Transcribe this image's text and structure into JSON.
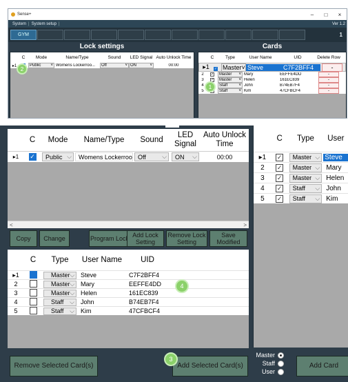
{
  "inset": {
    "title": "Sense+",
    "window_controls": [
      "–",
      "□",
      "×"
    ],
    "menu": [
      "System",
      "System setup"
    ],
    "version": "Ver 1.2",
    "active_tab": "GYM",
    "page_number": "1",
    "lock_settings_title": "Lock settings",
    "cards_title": "Cards",
    "lock_headers": [
      "C",
      "Mode",
      "Name/Type",
      "Sound",
      "LED Signal",
      "Auto Unlock Time"
    ],
    "lock_row": {
      "indicator": "▸1",
      "mode": "Public",
      "name": "Womens Lockerroo...",
      "sound": "Off",
      "led": "ON",
      "time": "00:00"
    },
    "card_headers": [
      "C",
      "Type",
      "User Name",
      "UID",
      "Delete Row"
    ],
    "cards": [
      {
        "idx": "▸1",
        "type": "Master",
        "name": "Steve",
        "uid": "C7F2BFF4",
        "del": "-"
      },
      {
        "idx": "2",
        "type": "Master",
        "name": "Mary",
        "uid": "EEFFE4DD",
        "del": "-"
      },
      {
        "idx": "3",
        "type": "Master",
        "name": "Helen",
        "uid": "161EC839",
        "del": "-"
      },
      {
        "idx": "4",
        "type": "Staff",
        "name": "John",
        "uid": "B74EB7F4",
        "del": "-"
      },
      {
        "idx": "5",
        "type": "Staff",
        "name": "Kim",
        "uid": "47CFBCF4",
        "del": "-"
      }
    ],
    "badge_1": "1",
    "badge_2": "2"
  },
  "lock_grid": {
    "headers": {
      "c": "C",
      "mode": "Mode",
      "name": "Name/Type",
      "sound": "Sound",
      "led": "LED Signal",
      "auto": "Auto Unlock Time"
    },
    "row": {
      "indicator": "▸1",
      "mode": "Public",
      "name": "Womens Lockerroo...",
      "sound": "Off",
      "led": "ON",
      "time": "00:00"
    },
    "scroll_left": "<",
    "scroll_right": ">"
  },
  "cards_grid": {
    "headers": {
      "c": "C",
      "type": "Type",
      "user": "User"
    },
    "rows": [
      {
        "idx": "▸1",
        "type": "Master",
        "name": "Steve"
      },
      {
        "idx": "2",
        "type": "Master",
        "name": "Mary"
      },
      {
        "idx": "3",
        "type": "Master",
        "name": "Helen"
      },
      {
        "idx": "4",
        "type": "Staff",
        "name": "John"
      },
      {
        "idx": "5",
        "type": "Staff",
        "name": "Kim"
      }
    ]
  },
  "buttons": {
    "copy": "Copy",
    "change": "Change",
    "program_lock": "Program Lock",
    "add_lock_setting": "Add Lock Setting",
    "remove_lock_setting": "Remove Lock Setting",
    "save_modified": "Save Modified",
    "remove_selected": "Remove Selected Card(s)",
    "add_selected": "Add Selected Card(s)",
    "add_card": "Add Card"
  },
  "user_grid": {
    "headers": {
      "c": "C",
      "type": "Type",
      "user": "User Name",
      "uid": "UID"
    },
    "rows": [
      {
        "idx": "▸1",
        "type": "Master",
        "name": "Steve",
        "uid": "C7F2BFF4"
      },
      {
        "idx": "2",
        "type": "Master",
        "name": "Mary",
        "uid": "EEFFE4DD"
      },
      {
        "idx": "3",
        "type": "Master",
        "name": "Helen",
        "uid": "161EC839"
      },
      {
        "idx": "4",
        "type": "Staff",
        "name": "John",
        "uid": "B74EB7F4"
      },
      {
        "idx": "5",
        "type": "Staff",
        "name": "Kim",
        "uid": "47CFBCF4"
      }
    ]
  },
  "badges": {
    "b3": "3",
    "b4": "4"
  },
  "radios": [
    {
      "label": "Master",
      "selected": true
    },
    {
      "label": "Staff",
      "selected": false
    },
    {
      "label": "User",
      "selected": false
    }
  ],
  "colors": {
    "frame": "#2e3d49",
    "button": "#5d7f70",
    "selection": "#1a73d0",
    "badge": "#8bd16a"
  }
}
